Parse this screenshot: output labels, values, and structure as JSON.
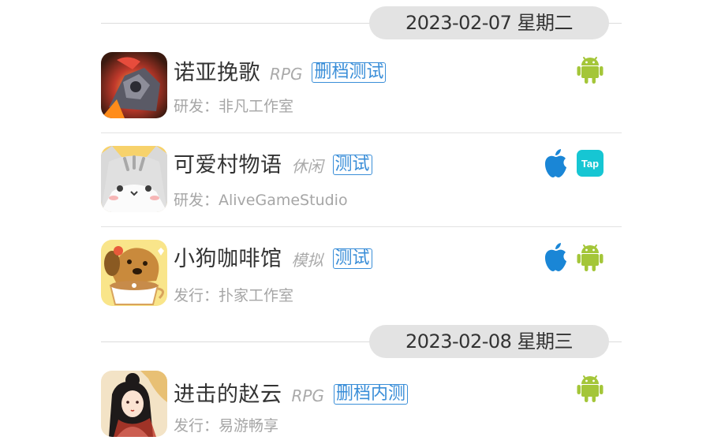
{
  "sections": [
    {
      "date": "2023-02-07 星期二",
      "games": [
        {
          "name": "诺亚挽歌",
          "genre": "RPG",
          "badge": "删档测试",
          "dev": "研发：非凡工作室",
          "platforms": [
            "android"
          ]
        },
        {
          "name": "可爱村物语",
          "genre": "休闲",
          "badge": "测试",
          "dev": "研发：AliveGameStudio",
          "platforms": [
            "ios",
            "taptap"
          ]
        },
        {
          "name": "小狗咖啡馆",
          "genre": "模拟",
          "badge": "测试",
          "dev": "发行：扑家工作室",
          "platforms": [
            "ios",
            "android"
          ]
        }
      ]
    },
    {
      "date": "2023-02-08 星期三",
      "games": [
        {
          "name": "进击的赵云",
          "genre": "RPG",
          "badge": "删档内测",
          "dev": "发行：易游畅享",
          "platforms": [
            "android"
          ]
        }
      ]
    }
  ],
  "platform_icons": {
    "android": "android-icon",
    "ios": "apple-icon",
    "taptap": "taptap-icon"
  },
  "taptap_label": "Tap",
  "colors": {
    "android": "#a4c639",
    "ios": "#1a86d6",
    "taptap": "#16c6d3",
    "badge": "#3a8ed8"
  }
}
